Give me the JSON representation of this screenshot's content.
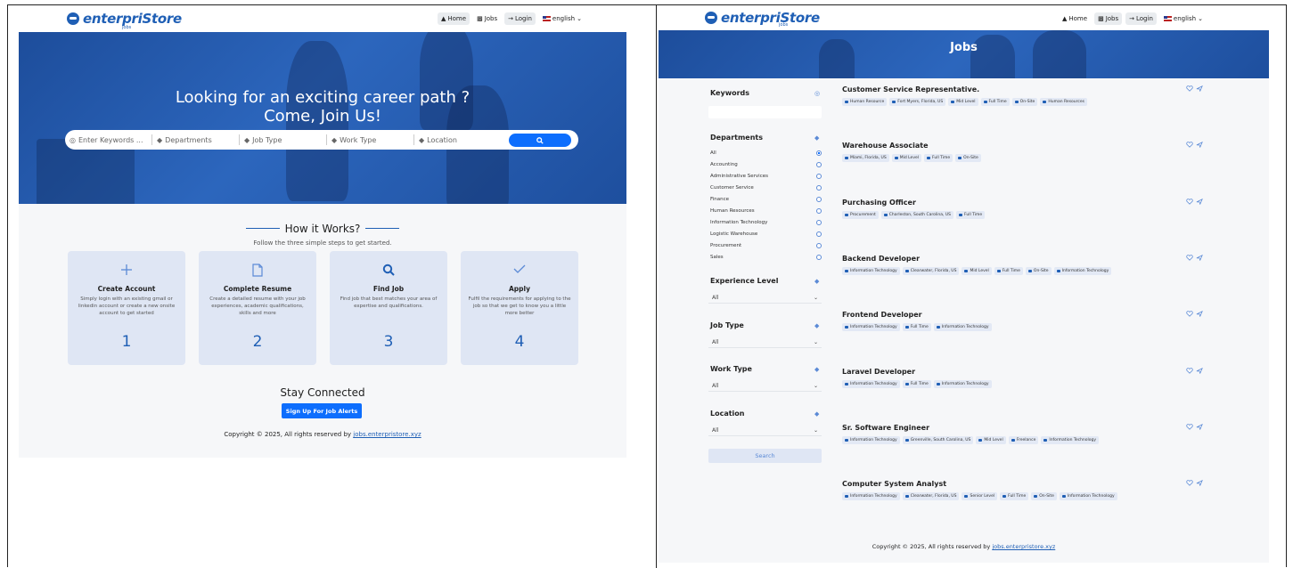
{
  "left_page": {
    "logo": {
      "text": "enterpriStore",
      "sub": "jobs"
    },
    "nav": {
      "home": "Home",
      "jobs": "Jobs",
      "login": "Login",
      "language": "english"
    },
    "hero": {
      "title_line1": "Looking for an exciting career path ?",
      "title_line2": "Come, Join Us!",
      "search": {
        "keywords_placeholder": "Enter Keywords ...",
        "departments": "Departments",
        "job_type": "Job Type",
        "work_type": "Work Type",
        "location": "Location"
      }
    },
    "how_it_works": {
      "title": "How it Works?",
      "subtitle": "Follow the three simple steps to get started.",
      "steps": [
        {
          "icon": "plus-icon",
          "title": "Create Account",
          "desc": "Simply login with an existing gmail or linkedin account or create a new onsite account to get started",
          "num": "1"
        },
        {
          "icon": "document-icon",
          "title": "Complete Resume",
          "desc": "Create a detailed resume with your job experiences, academic qualifications, skills and more",
          "num": "2"
        },
        {
          "icon": "search-icon",
          "title": "Find Job",
          "desc": "Find job that best matches your area of expertise and qualifications.",
          "num": "3"
        },
        {
          "icon": "check-icon",
          "title": "Apply",
          "desc": "Fulfil the requirements for applying to the job so that we get to know you a little more better",
          "num": "4"
        }
      ]
    },
    "stay_connected": {
      "title": "Stay Connected",
      "button": "Sign Up For Job Alerts"
    },
    "footer": {
      "text": "Copyright © 2025, All rights reserved by ",
      "link": "jobs.enterpristore.xyz"
    }
  },
  "right_page": {
    "logo": {
      "text": "enterpriStore",
      "sub": "jobs"
    },
    "nav": {
      "home": "Home",
      "jobs": "Jobs",
      "login": "Login",
      "language": "english"
    },
    "hero_title": "Jobs",
    "filters": {
      "keywords": "Keywords",
      "departments": "Departments",
      "department_options": [
        "All",
        "Accounting",
        "Administrative Services",
        "Customer Service",
        "Finance",
        "Human Resources",
        "Information Technology",
        "Logistic Warehouse",
        "Procurement",
        "Sales"
      ],
      "experience_level": "Experience Level",
      "experience_value": "All",
      "job_type": "Job Type",
      "job_type_value": "All",
      "work_type": "Work Type",
      "work_type_value": "All",
      "location": "Location",
      "location_value": "All",
      "search_button": "Search"
    },
    "jobs": [
      {
        "title": "Customer Service Representative.",
        "tags": [
          "Human Resource",
          "Fort Myers, Florida, US",
          "Mid Level",
          "Full Time",
          "On-Site",
          "Human Resources"
        ]
      },
      {
        "title": "Warehouse Associate",
        "tags": [
          "Miami, Florida, US",
          "Mid Level",
          "Full Time",
          "On-Site"
        ]
      },
      {
        "title": "Purchasing Officer",
        "tags": [
          "Procurement",
          "Charleston, South Carolina, US",
          "Full Time"
        ]
      },
      {
        "title": "Backend Developer",
        "tags": [
          "Information Technology",
          "Clearwater, Florida, US",
          "Mid Level",
          "Full Time",
          "On-Site",
          "Information Technology"
        ]
      },
      {
        "title": "Frontend Developer",
        "tags": [
          "Information Technology",
          "Full Time",
          "Information Technology"
        ]
      },
      {
        "title": "Laravel Developer",
        "tags": [
          "Information Technology",
          "Full Time",
          "Information Technology"
        ]
      },
      {
        "title": "Sr. Software Engineer",
        "tags": [
          "Information Technology",
          "Greenville, South Carolina, US",
          "Mid Level",
          "Freelance",
          "Information Technology"
        ]
      },
      {
        "title": "Computer System Analyst",
        "tags": [
          "Information Technology",
          "Clearwater, Florida, US",
          "Senior Level",
          "Full Time",
          "On-Site",
          "Information Technology"
        ]
      }
    ],
    "footer": {
      "text": "Copyright © 2025, All rights reserved by ",
      "link": "jobs.enterpristore.xyz"
    }
  }
}
